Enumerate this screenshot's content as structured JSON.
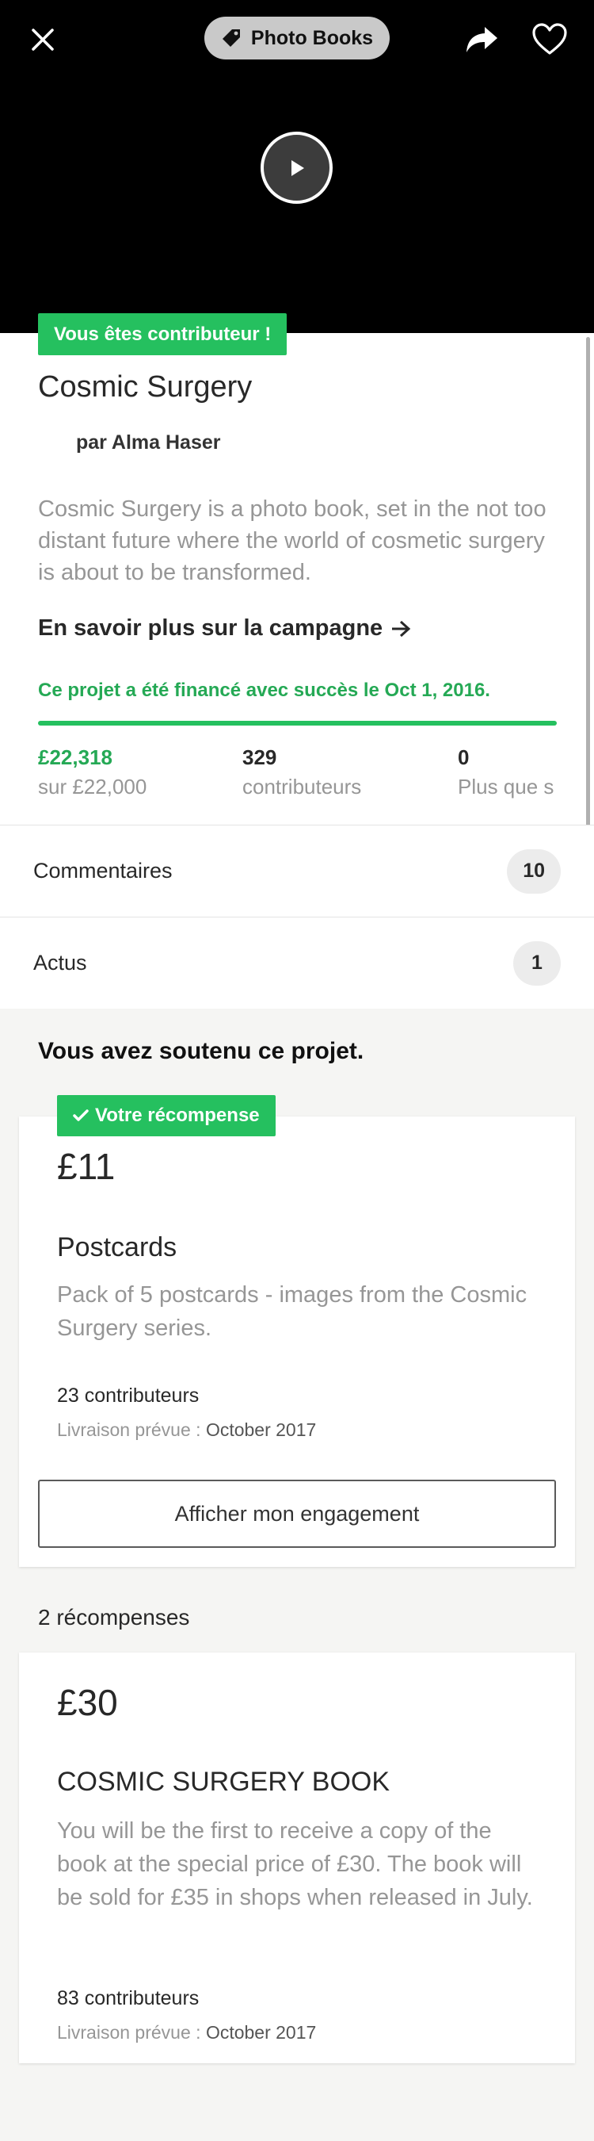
{
  "header": {
    "category": "Photo Books",
    "icons": {
      "close": "close-icon",
      "tag": "tag-icon",
      "share": "share-icon",
      "heart": "heart-icon",
      "play": "play-icon"
    }
  },
  "project": {
    "backer_badge": "Vous êtes contributeur !",
    "title": "Cosmic Surgery",
    "creator": "par Alma Haser",
    "blurb": "Cosmic Surgery is a photo book, set in the not too distant future where the world of cosmetic surgery is about to be transformed.",
    "learn_more": "En savoir plus sur la campagne",
    "funded_message": "Ce projet a été financé avec succès le Oct 1, 2016.",
    "progress": 1.0,
    "stats": [
      {
        "value": "£22,318",
        "label": "sur £22,000"
      },
      {
        "value": "329",
        "label": "contributeurs"
      },
      {
        "value": "0",
        "label": "Plus que s"
      }
    ]
  },
  "sections": {
    "comments": {
      "label": "Commentaires",
      "count": "10"
    },
    "updates": {
      "label": "Actus",
      "count": "1"
    }
  },
  "backed": {
    "title": "Vous avez soutenu ce projet.",
    "your_reward_label": "Votre récompense",
    "reward": {
      "amount": "£11",
      "title": "Postcards",
      "description": "Pack of 5 postcards - images from the Cosmic Surgery series.",
      "backers": "23 contributeurs",
      "delivery_label": "Livraison prévue :",
      "delivery_date": "October 2017"
    },
    "manage_button": "Afficher mon engagement"
  },
  "rewards": {
    "count_label": "2 récompenses",
    "items": [
      {
        "amount": "£30",
        "title": "COSMIC SURGERY BOOK",
        "description": "You will be the first to receive a copy of the book at the special price of £30. The book will be sold for £35 in shops when released in July.",
        "backers": "83 contributeurs",
        "delivery_label": "Livraison prévue :",
        "delivery_date": "October 2017"
      }
    ]
  },
  "colors": {
    "accent_green": "#25c05f",
    "text_green": "#25a955",
    "muted_text": "#969696"
  }
}
